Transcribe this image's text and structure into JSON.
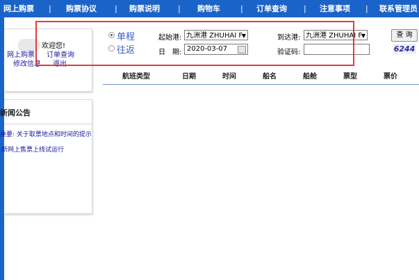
{
  "nav": [
    {
      "label": "网上购票"
    },
    {
      "label": "购票协议"
    },
    {
      "label": "购票说明"
    },
    {
      "label": "购物车"
    },
    {
      "label": "订单查询"
    },
    {
      "label": "注意事项"
    },
    {
      "label": "联系管理员"
    }
  ],
  "nav_separator": "|",
  "user": {
    "welcome": "欢迎您!",
    "links": [
      "网上购票",
      "订单查询",
      "修改信息",
      "退出"
    ]
  },
  "news": {
    "title": "新闻公告",
    "items": [
      "重要: 关于取票地点和时间的提示",
      "新网上售票上线试运行"
    ]
  },
  "search": {
    "trip_types": [
      "单程",
      "往返"
    ],
    "selected_trip": "单程",
    "from_label": "起始港:",
    "from_value": "九洲港 ZHUHAI F",
    "to_label": "到达港:",
    "to_value": "九洲港 ZHUHAI F",
    "date_label": "日　期:",
    "date_value": "2020-03-07",
    "captcha_label": "验证码:",
    "captcha_value": "",
    "captcha_code": "6244",
    "query_button": "查 询"
  },
  "table": {
    "headers": [
      "航班类型",
      "日期",
      "时间",
      "船名",
      "船舱",
      "票型",
      "票价"
    ]
  },
  "colors": {
    "nav_bg": "#1a63c8",
    "highlight_box": "#e33b3b",
    "link": "#1a1aa0"
  }
}
